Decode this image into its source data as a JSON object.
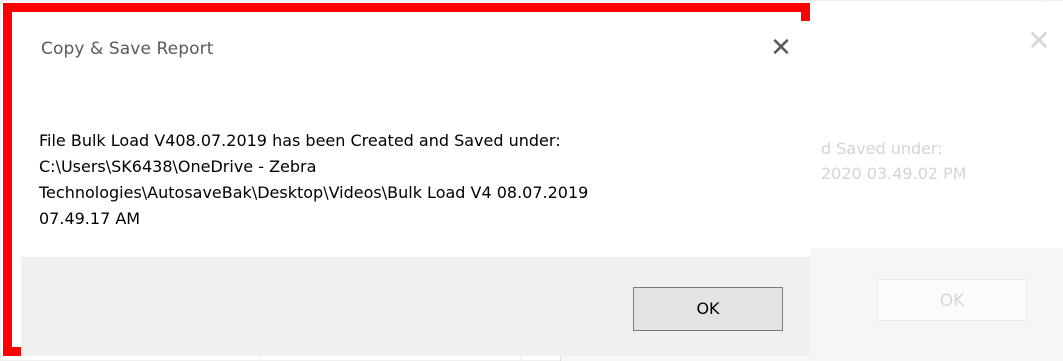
{
  "dialog": {
    "title": "Copy & Save Report",
    "close_glyph": "✕",
    "message_lines": [
      "File Bulk Load V408.07.2019 has been Created and Saved under:",
      "C:\\Users\\SK6438\\OneDrive - Zebra",
      "Technologies\\AutosaveBak\\Desktop\\Videos\\Bulk Load V4 08.07.2019",
      "07.49.17 AM"
    ],
    "ok_label": "OK"
  },
  "background_dialog": {
    "close_glyph": "✕",
    "message_fragment_1": "d Saved under:",
    "message_fragment_2": "2020 03.49.02 PM",
    "ok_label": "OK"
  },
  "colors": {
    "highlight_frame": "#ff0000",
    "footer_bg": "#f0f0f0",
    "title_text": "#5a5a5a"
  },
  "icons": {
    "close": "close-icon"
  }
}
